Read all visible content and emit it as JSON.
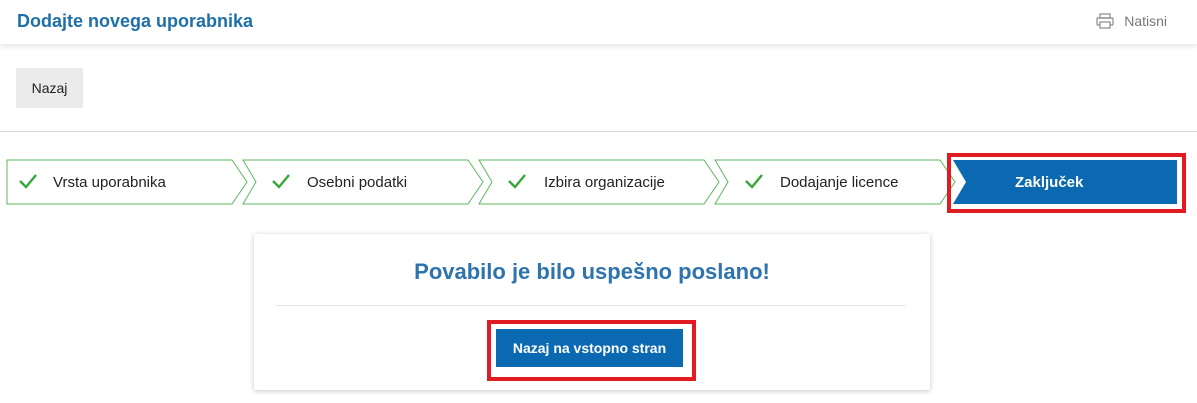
{
  "header": {
    "title": "Dodajte novega uporabnika",
    "print_label": "Natisni",
    "print_icon": "printer-icon"
  },
  "toolbar": {
    "back_label": "Nazaj"
  },
  "wizard": {
    "steps": [
      {
        "label": "Vrsta uporabnika",
        "status": "completed",
        "icon": "checkmark-icon"
      },
      {
        "label": "Osebni podatki",
        "status": "completed",
        "icon": "checkmark-icon"
      },
      {
        "label": "Izbira organizacije",
        "status": "completed",
        "icon": "checkmark-icon"
      },
      {
        "label": "Dodajanje licence",
        "status": "completed",
        "icon": "checkmark-icon"
      },
      {
        "label": "Zaključek",
        "status": "active"
      }
    ],
    "colors": {
      "completed_border": "#5cb85c",
      "check": "#3aa63a",
      "active_fill": "#0a69b0",
      "highlight": "#e11b22"
    }
  },
  "result": {
    "message": "Povabilo je bilo uspešno poslano!",
    "button_label": "Nazaj na vstopno stran"
  }
}
